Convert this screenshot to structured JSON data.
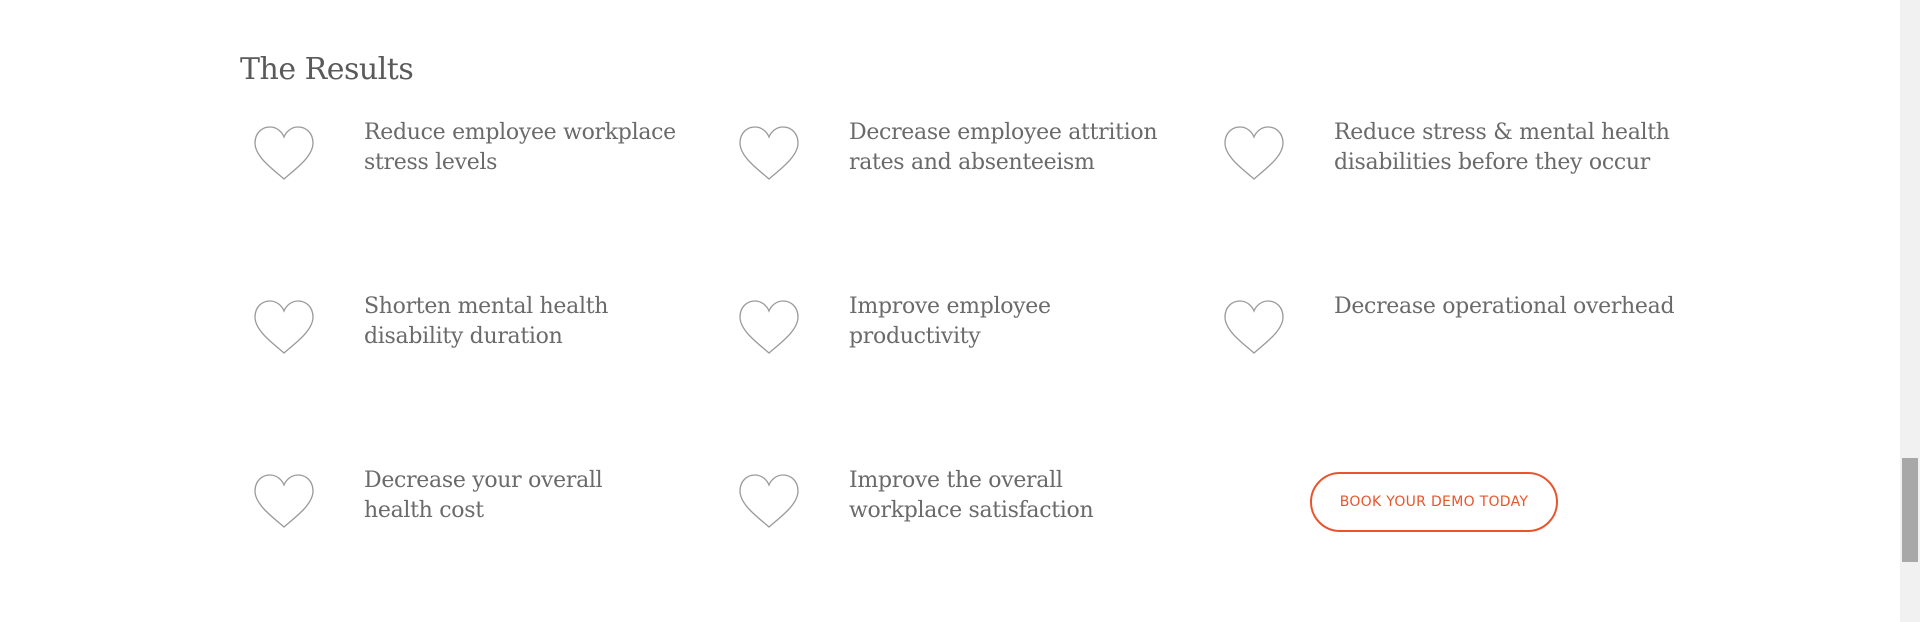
{
  "section": {
    "heading": "The Results",
    "items": [
      {
        "icon": "heart-icon",
        "text": "Reduce employee workplace stress levels",
        "lines": [
          "Reduce employee workplace",
          "stress levels"
        ]
      },
      {
        "icon": "heart-icon",
        "text": "Decrease employee attrition rates and absenteeism",
        "lines": [
          "Decrease employee attrition",
          "rates and absenteeism"
        ]
      },
      {
        "icon": "heart-icon",
        "text": "Reduce stress & mental health disabilities before they occur",
        "lines": [
          "Reduce stress & mental health",
          "disabilities before they occur"
        ]
      },
      {
        "icon": "heart-icon",
        "text": "Shorten mental health disability duration",
        "lines": [
          "Shorten mental health",
          "disability duration"
        ]
      },
      {
        "icon": "heart-icon",
        "text": "Improve employee productivity",
        "lines": [
          "Improve employee",
          "productivity"
        ]
      },
      {
        "icon": "heart-icon",
        "text": "Decrease operational overhead",
        "lines": [
          "Decrease operational overhead",
          ""
        ]
      },
      {
        "icon": "heart-icon",
        "text": "Decrease your overall health cost",
        "lines": [
          "Decrease your overall",
          "health cost"
        ]
      },
      {
        "icon": "heart-icon",
        "text": "Improve the overall workplace satisfaction",
        "lines": [
          "Improve the overall",
          "workplace satisfaction"
        ]
      }
    ],
    "cta": {
      "label": "BOOK YOUR DEMO TODAY"
    }
  },
  "colors": {
    "accent": "#e8552d",
    "heading": "#5a5a5a",
    "body_text": "#6a6a6a",
    "icon_stroke": "#9a9a9a",
    "scrollbar_thumb": "#a8a8a8"
  }
}
